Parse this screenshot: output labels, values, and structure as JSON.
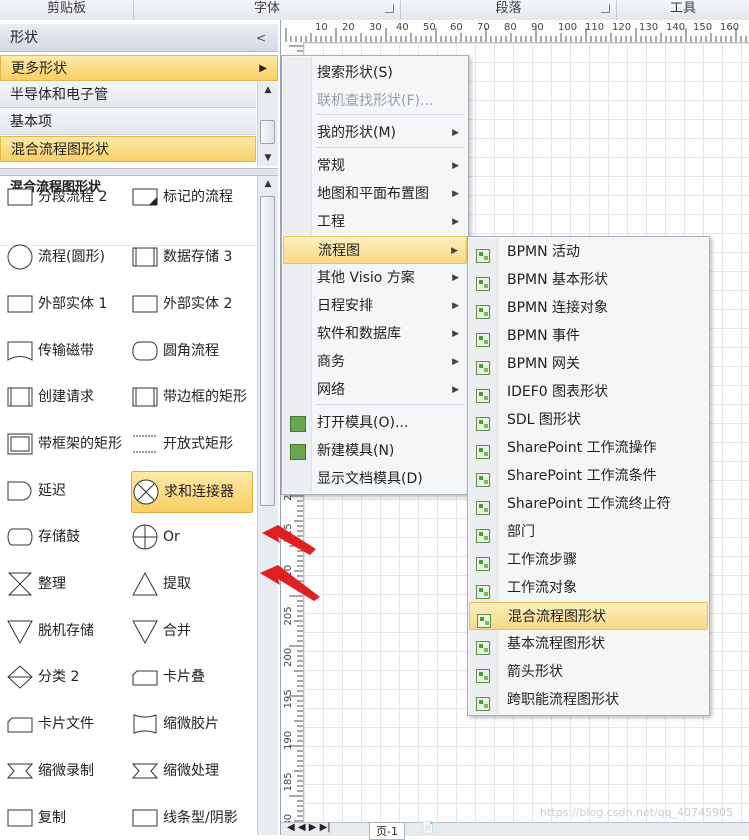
{
  "ribbon": {
    "groups": [
      "剪贴板",
      "字体",
      "段落",
      "工具"
    ]
  },
  "panel": {
    "title": "形状",
    "more_shapes": "更多形状",
    "stencils": [
      "半导体和电子管",
      "基本项",
      "混合流程图形状"
    ],
    "section_title": "混合流程图形状",
    "shapes": [
      [
        "分段流程 2",
        "标记的流程"
      ],
      [
        "流程(圆形)",
        "数据存储 3"
      ],
      [
        "外部实体 1",
        "外部实体 2"
      ],
      [
        "传输磁带",
        "圆角流程"
      ],
      [
        "创建请求",
        "带边框的矩形"
      ],
      [
        "带框架的矩形",
        "开放式矩形"
      ],
      [
        "延迟",
        "求和连接器"
      ],
      [
        "存储鼓",
        "Or"
      ],
      [
        "整理",
        "提取"
      ],
      [
        "脱机存储",
        "合并"
      ],
      [
        "分类 2",
        "卡片叠"
      ],
      [
        "卡片文件",
        "缩微胶片"
      ],
      [
        "缩微录制",
        "缩微处理"
      ],
      [
        "复制",
        "线条型/阴影"
      ]
    ],
    "selected_shape": "求和连接器"
  },
  "ruler": {
    "top_labels": [
      "10",
      "20",
      "30",
      "40",
      "50",
      "60",
      "70",
      "80",
      "90",
      "100",
      "110",
      "120",
      "130",
      "140",
      "150",
      "160"
    ],
    "left_labels": [
      "270",
      "265",
      "260",
      "255",
      "250",
      "245",
      "240",
      "235",
      "230",
      "225",
      "220",
      "215",
      "210",
      "205",
      "200",
      "195",
      "190",
      "185",
      "180"
    ]
  },
  "menu1": {
    "items": [
      {
        "label": "搜索形状(S)",
        "state": "normal"
      },
      {
        "label": "联机查找形状(F)...",
        "state": "disabled"
      },
      {
        "label": "我的形状(M)",
        "state": "submenu"
      },
      {
        "label": "常规",
        "state": "submenu"
      },
      {
        "label": "地图和平面布置图",
        "state": "submenu"
      },
      {
        "label": "工程",
        "state": "submenu"
      },
      {
        "label": "流程图",
        "state": "highlighted"
      },
      {
        "label": "其他 Visio 方案",
        "state": "submenu"
      },
      {
        "label": "日程安排",
        "state": "submenu"
      },
      {
        "label": "软件和数据库",
        "state": "submenu"
      },
      {
        "label": "商务",
        "state": "submenu"
      },
      {
        "label": "网络",
        "state": "submenu"
      },
      {
        "label": "打开模具(O)...",
        "state": "normal"
      },
      {
        "label": "新建模具(N)",
        "state": "normal"
      },
      {
        "label": "显示文档模具(D)",
        "state": "normal"
      }
    ]
  },
  "menu2": {
    "items": [
      "BPMN 活动",
      "BPMN 基本形状",
      "BPMN 连接对象",
      "BPMN 事件",
      "BPMN 网关",
      "IDEF0 图表形状",
      "SDL 图形状",
      "SharePoint 工作流操作",
      "SharePoint 工作流条件",
      "SharePoint 工作流终止符",
      "部门",
      "工作流步骤",
      "工作流对象",
      "混合流程图形状",
      "基本流程图形状",
      "箭头形状",
      "跨职能流程图形状"
    ],
    "highlighted": "混合流程图形状"
  },
  "pagebar": {
    "tab": "页-1"
  },
  "watermark": "https://blog.csdn.net/qq_40745905",
  "colors": {
    "highlight": "#f8cf63",
    "arrow": "#e02020",
    "menu_bg": "#f5f6f8"
  }
}
